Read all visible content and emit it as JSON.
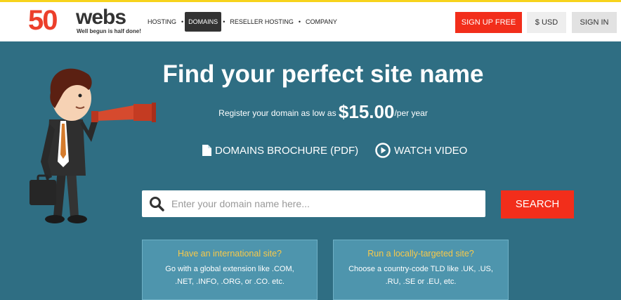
{
  "header": {
    "logo": {
      "number": "50",
      "word": "webs",
      "tagline": "Well begun is half done!"
    },
    "nav": [
      {
        "label": "HOSTING",
        "active": false
      },
      {
        "label": "DOMAINS",
        "active": true
      },
      {
        "label": "RESELLER HOSTING",
        "active": false
      },
      {
        "label": "COMPANY",
        "active": false
      }
    ],
    "signup_label": "SIGN UP FREE",
    "currency_label": "$ USD",
    "signin_label": "SIGN IN"
  },
  "hero": {
    "title": "Find your perfect site name",
    "sub_prefix": "Register your domain as low as ",
    "price": "$15.00",
    "price_suffix": "/per year",
    "brochure_label": "DOMAINS BROCHURE (PDF)",
    "video_label": "WATCH VIDEO"
  },
  "search": {
    "placeholder": "Enter your domain name here...",
    "value": "",
    "button_label": "SEARCH"
  },
  "cards": [
    {
      "title": "Have an international site?",
      "text": "Go with a global extension like .COM, .NET, .INFO, .ORG, or .CO. etc."
    },
    {
      "title": "Run a locally-targeted site?",
      "text": "Choose a country-code TLD like .UK, .US, .RU, .SE or .EU, etc."
    }
  ],
  "colors": {
    "accent": "#f22e1b",
    "hero_bg": "#2f6e83",
    "card_bg": "#4e95ad",
    "card_title": "#f8c94a",
    "topline": "#f7d31c"
  }
}
